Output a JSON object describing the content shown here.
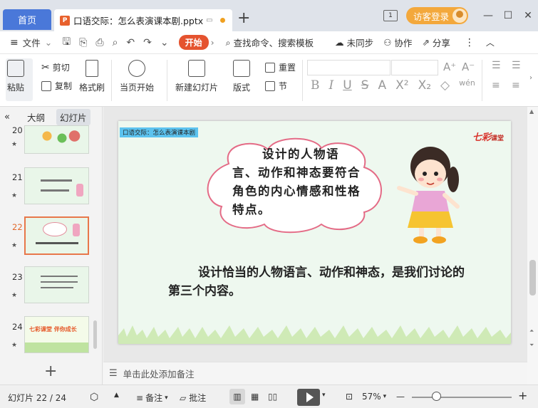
{
  "titlebar": {
    "home_tab": "首页",
    "doc_tab": "口语交际：怎么表演课本剧.pptx",
    "new_tab": "+",
    "page_badge": "1",
    "login": "访客登录"
  },
  "menubar": {
    "file": "文件",
    "start": "开始",
    "search_placeholder": "查找命令、搜索模板",
    "sync": "未同步",
    "collab": "协作",
    "share": "分享"
  },
  "ribbon": {
    "paste": "粘贴",
    "cut": "剪切",
    "copy": "复制",
    "format_painter": "格式刷",
    "from_current": "当页开始",
    "new_slide": "新建幻灯片",
    "layout": "版式",
    "reset": "重置",
    "section": "节",
    "font_size_a1": "A⁺",
    "font_size_a2": "A⁻"
  },
  "panel": {
    "tab_outline": "大纲",
    "tab_slides": "幻灯片",
    "thumbs": [
      {
        "num": "20"
      },
      {
        "num": "21"
      },
      {
        "num": "22"
      },
      {
        "num": "23"
      },
      {
        "num": "24"
      }
    ],
    "thumb24_text": "七彩课堂  伴你成长"
  },
  "slide": {
    "label": "口语交际：怎么表演课本剧",
    "brand_main": "七彩",
    "brand_sub": "课堂",
    "bubble_text": "设计的人物语言、动作和神态要符合角色的内心情感和性格特点。",
    "main_text": "设计恰当的人物语言、动作和神态，是我们讨论的第三个内容。"
  },
  "notes": {
    "placeholder": "单击此处添加备注"
  },
  "status": {
    "slide_counter": "幻灯片 22 / 24",
    "notes_btn": "备注",
    "comment_btn": "批注",
    "zoom": "57%",
    "zoom_level_percent": 57
  },
  "colors": {
    "accent_blue": "#4a78d9",
    "start_red": "#e5532f",
    "login_orange": "#f3a83c",
    "selected_thumb": "#e8774a",
    "slide_bg": "#eef8ef"
  }
}
